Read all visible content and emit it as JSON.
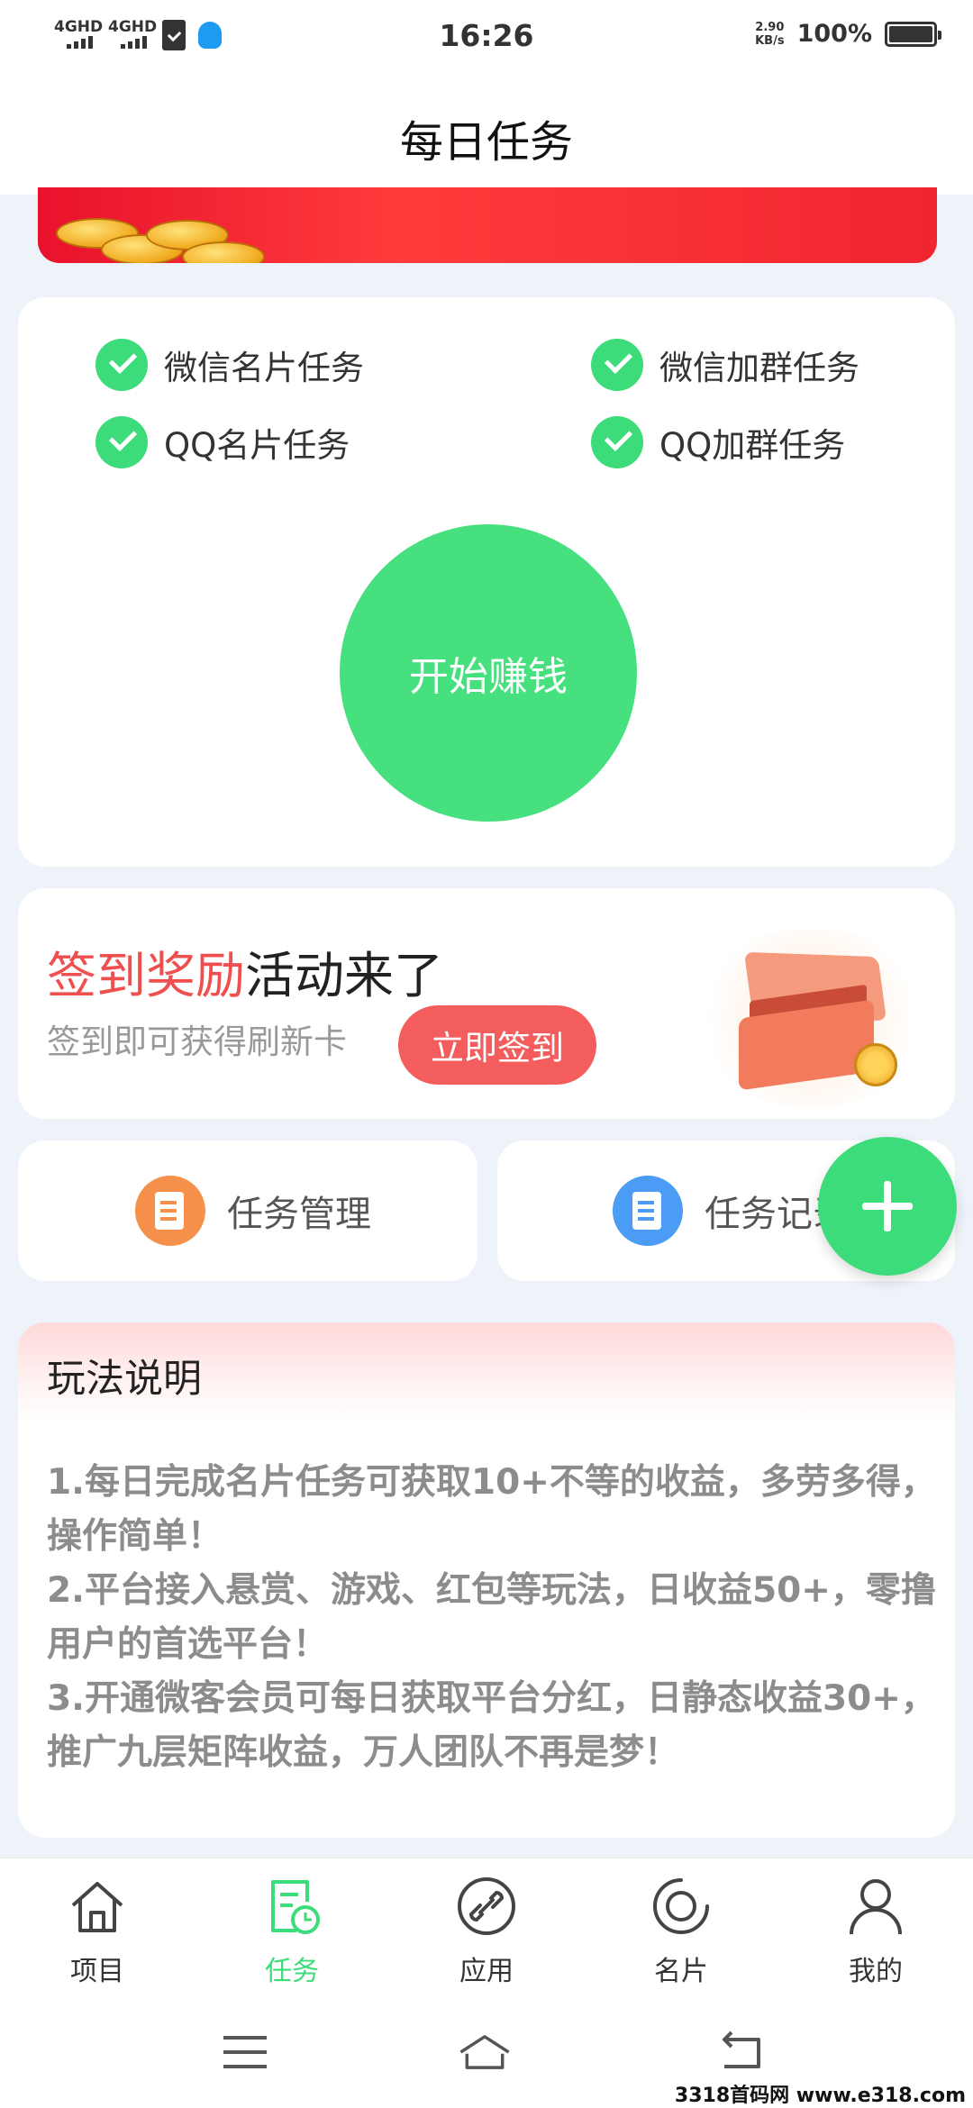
{
  "status_bar": {
    "network1": "4GHD",
    "network2": "4GHD",
    "time": "16:26",
    "speed_value": "2.90",
    "speed_unit": "KB/s",
    "battery": "100%"
  },
  "header": {
    "title": "每日任务"
  },
  "tasks": {
    "items": [
      "微信名片任务",
      "微信加群任务",
      "QQ名片任务",
      "QQ加群任务"
    ],
    "start_label": "开始赚钱"
  },
  "signin": {
    "title_highlight": "签到奖励",
    "title_rest": "活动来了",
    "subtitle": "签到即可获得刷新卡",
    "button": "立即签到"
  },
  "quick": {
    "manage": "任务管理",
    "records": "任务记录"
  },
  "rules": {
    "title": "玩法说明",
    "lines": [
      "1.每日完成名片任务可获取10+不等的收益，多劳多得，操作简单！",
      "2.平台接入悬赏、游戏、红包等玩法，日收益50+，零撸用户的首选平台！",
      "3.开通微客会员可每日获取平台分红，日静态收益30+，推广九层矩阵收益，万人团队不再是梦！"
    ]
  },
  "bottom_nav": {
    "items": [
      "项目",
      "任务",
      "应用",
      "名片",
      "我的"
    ],
    "active_index": 1,
    "active_color": "#3ddc7a"
  },
  "watermark": "3318首码网 www.e318.com"
}
